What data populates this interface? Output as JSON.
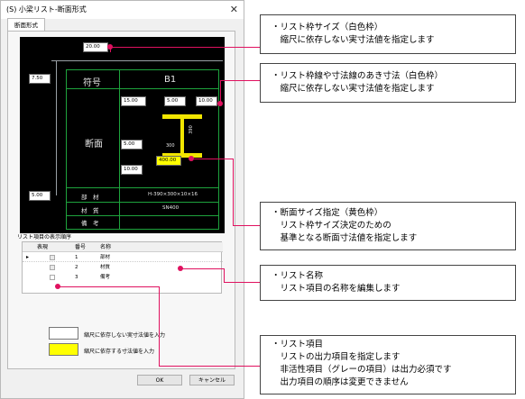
{
  "window": {
    "title": "(S) 小梁リスト-断面形式",
    "close_glyph": "✕"
  },
  "tab": {
    "label": "断面形式"
  },
  "drawing": {
    "frame_size": "20.00",
    "left_top_offset": "7.50",
    "left_bottom_offset": "5.00",
    "label_symbol": "符号",
    "symbol_value": "B1",
    "label_section": "断面",
    "gap_15": "15.00",
    "gap_5_top": "5.00",
    "gap_10_right": "10.00",
    "gap_5_mid": "5.00",
    "gap_10_bottom": "10.00",
    "dim_390": "390",
    "dim_300": "300",
    "section_size": "400.00",
    "row_member_label": "部　材",
    "row_member_value": "H-390×300×10×16",
    "row_material_label": "材　質",
    "row_material_value": "SN400",
    "row_note_label": "備　考"
  },
  "list": {
    "label": "リスト項目の表示順序",
    "headers": {
      "show": "表現",
      "num": "番号",
      "name": "名称"
    },
    "rows": [
      {
        "num": "1",
        "name": "部材"
      },
      {
        "num": "2",
        "name": "材質"
      },
      {
        "num": "3",
        "name": "備考"
      }
    ],
    "current_marker": "▸"
  },
  "legend": {
    "white_label": "縮尺に依存しない実寸法値を入力",
    "yellow_label": "縮尺に依存する寸法値を入力",
    "white_color": "#ffffff",
    "yellow_color": "#ffff00"
  },
  "buttons": {
    "ok": "OK",
    "cancel": "キャンセル"
  },
  "callouts": [
    {
      "line1": "・リスト枠サイズ（白色枠）",
      "line2": "　縮尺に依存しない実寸法値を指定します"
    },
    {
      "line1": "・リスト枠線や寸法線のあき寸法（白色枠）",
      "line2": "　縮尺に依存しない実寸法値を指定します"
    },
    {
      "line1": "・断面サイズ指定（黄色枠）",
      "line2": "　リスト枠サイズ決定のための",
      "line3": "　基準となる断面寸法値を指定します"
    },
    {
      "line1": "・リスト名称",
      "line2": "　リスト項目の名称を編集します"
    },
    {
      "line1": "・リスト項目",
      "line2": "　リストの出力項目を指定します",
      "line3": "　非活性項目（グレーの項目）は出力必須です",
      "line4": "　出力項目の順序は変更できません"
    }
  ],
  "colors": {
    "accent": "#e0115f",
    "grid": "#1ea33d",
    "highlight": "#ffff00"
  }
}
